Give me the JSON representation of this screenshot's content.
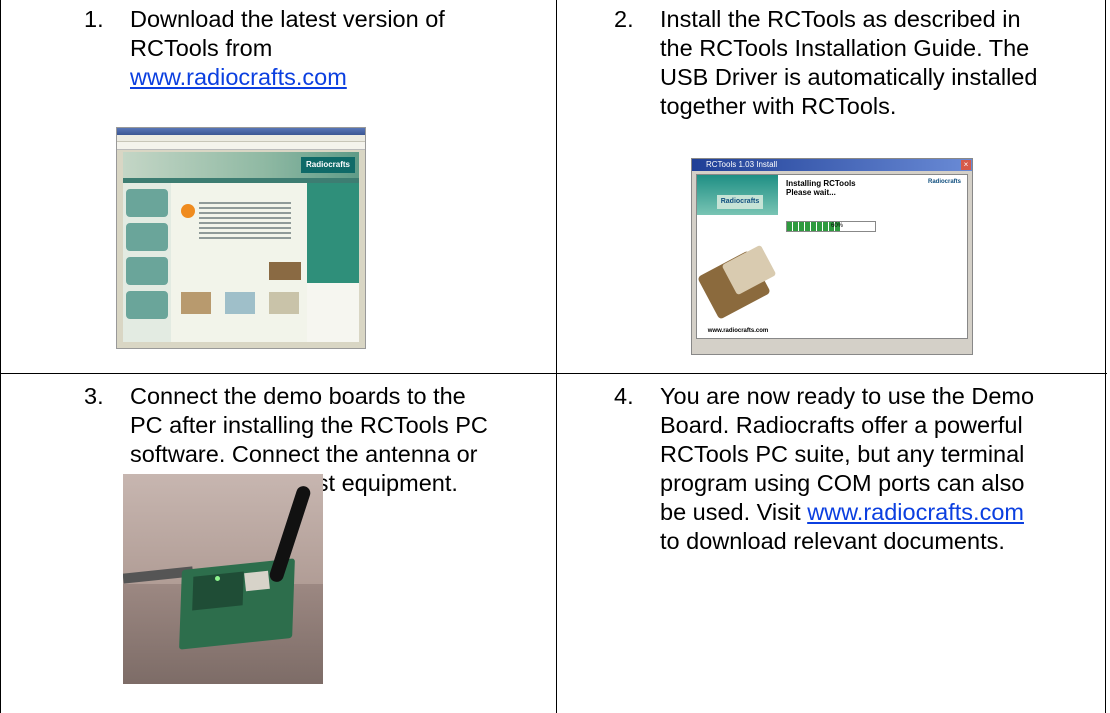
{
  "steps": [
    {
      "number": "1.",
      "lines": [
        "Download the latest version of",
        "RCTools from"
      ],
      "link": "www.radiocrafts.com"
    },
    {
      "number": "2.",
      "lines": [
        "Install the RCTools as described in",
        "the RCTools Installation Guide. The",
        "USB Driver is automatically installed",
        "together with RCTools."
      ]
    },
    {
      "number": "3.",
      "lines": [
        "Connect the demo boards to the",
        "PC after installing the RCTools PC",
        "software. Connect the antenna or",
        "connect to your test equipment."
      ]
    },
    {
      "number": "4.",
      "lines": [
        "You are now ready to use the Demo",
        "Board. Radiocrafts offer a powerful",
        "RCTools PC suite, but any terminal",
        "program using COM ports can also"
      ],
      "line5_prefix": "be used. Visit ",
      "link": "www.radiocrafts.com",
      "line6": "to download relevant documents."
    }
  ],
  "screenshot1": {
    "logo_text": "Radiocrafts"
  },
  "screenshot2": {
    "window_title": "RCTools 1.03 Install",
    "close_glyph": "×",
    "logo_text": "Radiocrafts",
    "heading_line1": "Installing RCTools",
    "heading_line2": "Please wait...",
    "right_logo": "Radiocrafts",
    "progress_percent": 0.6,
    "progress_label": "60%",
    "url_text": "www.radiocrafts.com"
  },
  "colors": {
    "link": "#0b3fe0",
    "border": "#000000"
  }
}
